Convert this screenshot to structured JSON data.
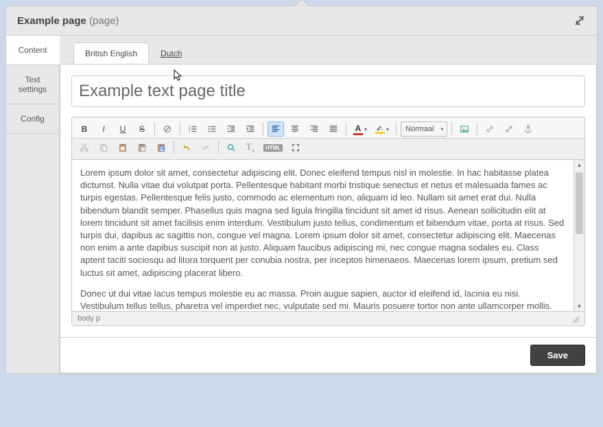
{
  "header": {
    "title": "Example page",
    "suffix": "(page)"
  },
  "link_icon": "link-remove-icon",
  "sidenav": {
    "items": [
      {
        "label": "Content",
        "active": true
      },
      {
        "label": "Text settings",
        "active": false
      },
      {
        "label": "Config",
        "active": false
      }
    ]
  },
  "lang_tabs": [
    {
      "label": "British English",
      "active": true
    },
    {
      "label": "Dutch",
      "active": false
    }
  ],
  "title_field": {
    "value": "Example text page title"
  },
  "toolbar": {
    "bold": "B",
    "italic": "I",
    "underline": "U",
    "strike": "S",
    "format_select": "Normaal"
  },
  "editor": {
    "paragraphs": [
      "Lorem ipsum dolor sit amet, consectetur adipiscing elit. Donec eleifend tempus nisl in molestie. In hac habitasse platea dictumst. Nulla vitae dui volutpat porta. Pellentesque habitant morbi tristique senectus et netus et malesuada fames ac turpis egestas. Pellentesque felis justo, commodo ac elementum non, aliquam id leo. Nullam sit amet erat dui. Nulla bibendum blandit semper. Phasellus quis magna sed ligula fringilla tincidunt sit amet id risus. Aenean sollicitudin elit at lorem tincidunt sit amet facilisis enim interdum. Vestibulum justo tellus, condimentum et bibendum vitae, porta at risus. Sed turpis dui, dapibus ac sagittis non, congue vel magna. Lorem ipsum dolor sit amet, consectetur adipiscing elit. Maecenas non enim a ante dapibus suscipit non at justo. Aliquam faucibus adipiscing mi, nec congue magna sodales eu. Class aptent taciti sociosqu ad litora torquent per conubia nostra, per inceptos himenaeos. Maecenas lorem ipsum, pretium sed luctus sit amet, adipiscing placerat libero.",
      "Donec ut dui vitae lacus tempus molestie eu ac massa. Proin augue sapien, auctor id eleifend id, lacinia eu nisi. Vestibulum tellus tellus, pharetra vel imperdiet nec, vulputate sed mi. Mauris posuere tortor non ante ullamcorper mollis. Nulla quam velit, interdum ut hebestrait vitae, adipiscing vel lectus. Duis posuere."
    ],
    "path": "body  p"
  },
  "footer": {
    "save_label": "Save"
  }
}
